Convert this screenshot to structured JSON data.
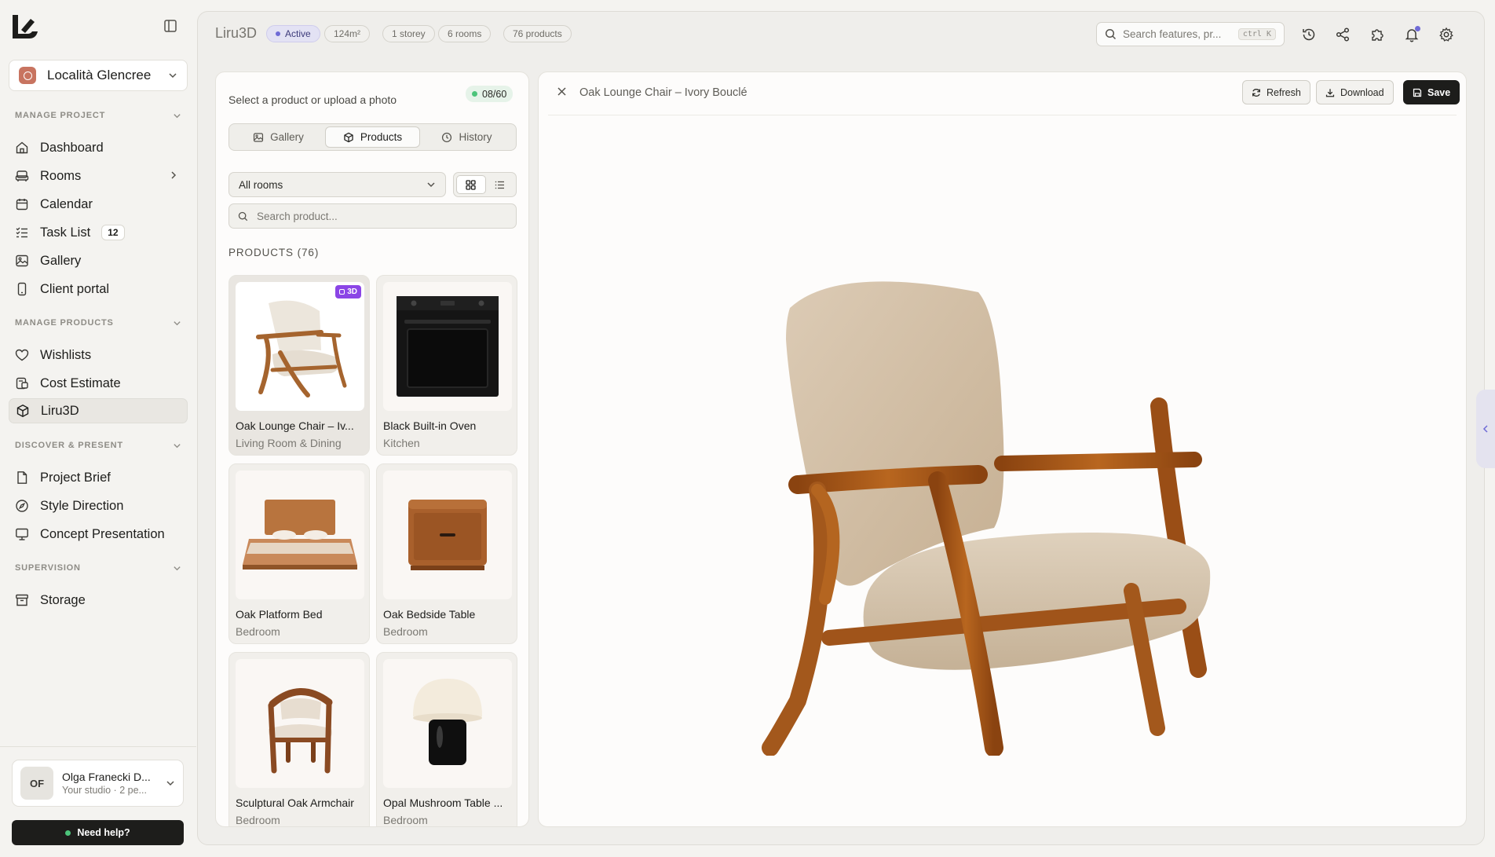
{
  "sidebar": {
    "project_name": "Località Glencree",
    "sections": {
      "manage_project": "MANAGE PROJECT",
      "manage_products": "MANAGE PRODUCTS",
      "discover_present": "DISCOVER & PRESENT",
      "supervision": "SUPERVISION"
    },
    "items": {
      "dashboard": "Dashboard",
      "rooms": "Rooms",
      "calendar": "Calendar",
      "task_list": "Task List",
      "task_count": "12",
      "gallery": "Gallery",
      "client_portal": "Client portal",
      "wishlists": "Wishlists",
      "cost_estimate": "Cost Estimate",
      "liru3d": "Liru3D",
      "project_brief": "Project Brief",
      "style_direction": "Style Direction",
      "concept_presentation": "Concept Presentation",
      "storage": "Storage"
    },
    "user": {
      "initials": "OF",
      "name": "Olga Franecki D...",
      "sub": "Your studio · 2 pe..."
    },
    "help_label": "Need help?"
  },
  "topbar": {
    "title": "Liru3D",
    "status": "Active",
    "area": "124m²",
    "storeys": "1 storey",
    "rooms": "6 rooms",
    "products": "76 products",
    "search_placeholder": "Search features, pr...",
    "shortcut": "ctrl K"
  },
  "left_panel": {
    "prompt": "Select a product or upload a photo",
    "counter": "08/60",
    "tabs": {
      "gallery": "Gallery",
      "products": "Products",
      "history": "History"
    },
    "room_filter": "All rooms",
    "search_placeholder": "Search product...",
    "heading": "PRODUCTS (76)",
    "badge_3d": "3D",
    "products": [
      {
        "name": "Oak Lounge Chair – Iv...",
        "room": "Living Room & Dining"
      },
      {
        "name": "Black Built-in Oven",
        "room": "Kitchen"
      },
      {
        "name": "Oak Platform Bed",
        "room": "Bedroom"
      },
      {
        "name": "Oak Bedside Table",
        "room": "Bedroom"
      },
      {
        "name": "Sculptural Oak Armchair",
        "room": "Bedroom"
      },
      {
        "name": "Opal Mushroom Table ...",
        "room": "Bedroom"
      }
    ]
  },
  "viewer": {
    "title": "Oak Lounge Chair – Ivory Bouclé",
    "refresh": "Refresh",
    "download": "Download",
    "save": "Save"
  },
  "colors": {
    "accent": "#6f6bd6",
    "dark": "#1d1d1b",
    "green": "#4cc47a",
    "badge_purple": "#8b45e6",
    "project_avatar": "#c87460"
  }
}
